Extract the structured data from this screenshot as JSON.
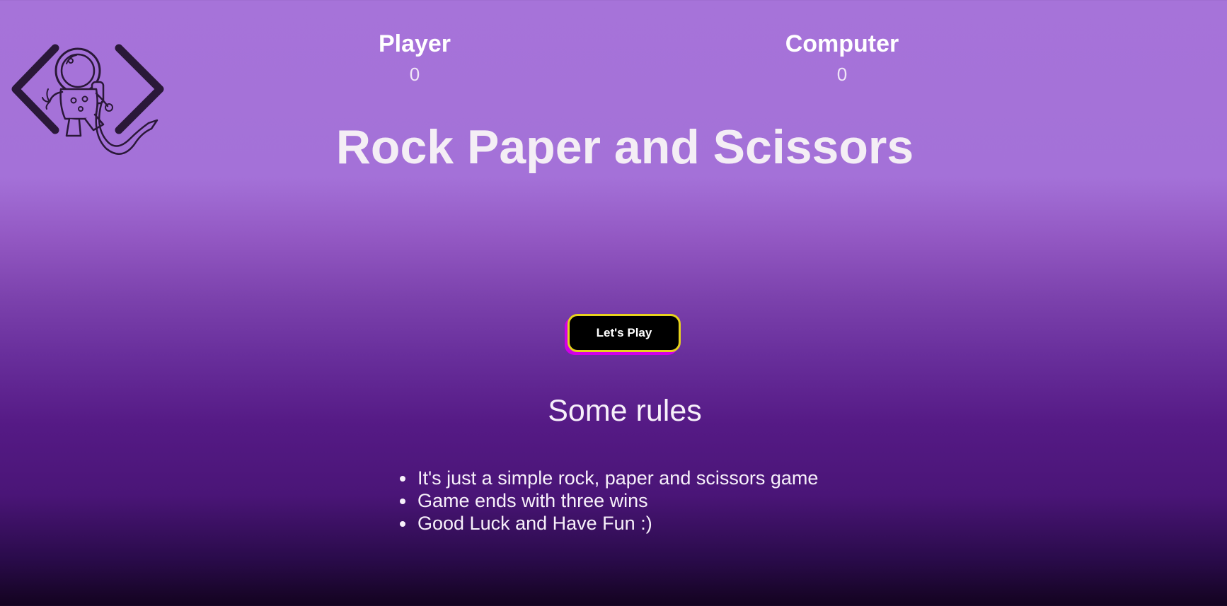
{
  "logo": {
    "icon": "astronaut-code-brackets-logo"
  },
  "scoreboard": {
    "player": {
      "label": "Player",
      "score": "0"
    },
    "computer": {
      "label": "Computer",
      "score": "0"
    }
  },
  "title": "Rock Paper and Scissors",
  "play_button": {
    "label": "Let's Play",
    "background": "#000000",
    "border_color": "#e6d21d",
    "shadow_color": "#d100e8"
  },
  "rules": {
    "heading": "Some rules",
    "items": [
      "It's just a simple rock, paper and scissors game",
      "Game ends with three wins",
      "Good Luck and Have Fun :)"
    ]
  },
  "colors": {
    "background_top": "#a673d9",
    "background_bottom": "#13031f",
    "text": "#f4eef5"
  }
}
